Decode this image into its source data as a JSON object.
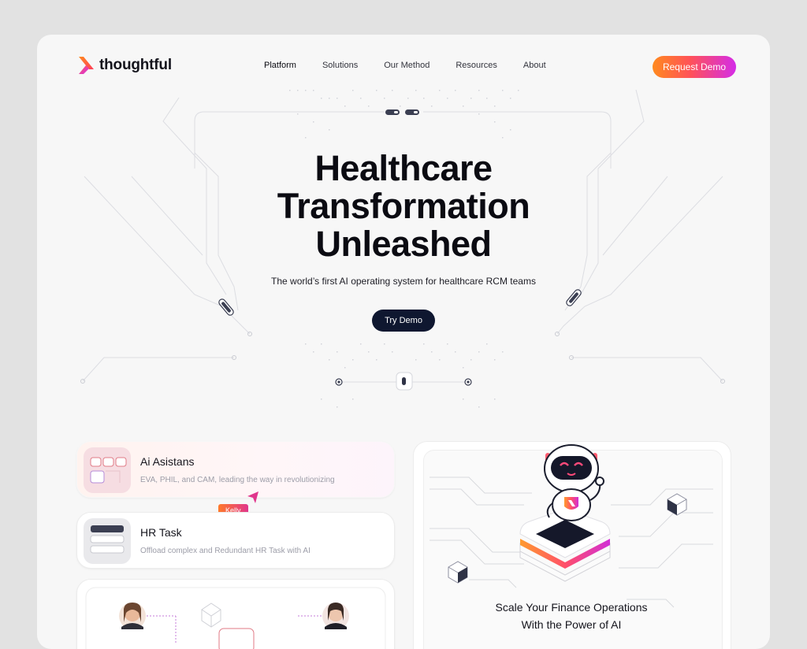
{
  "brand": {
    "name": "thoughtful"
  },
  "nav": {
    "items": [
      {
        "label": "Platform",
        "active": true
      },
      {
        "label": "Solutions",
        "active": false
      },
      {
        "label": "Our Method",
        "active": false
      },
      {
        "label": "Resources",
        "active": false
      },
      {
        "label": "About",
        "active": false
      }
    ],
    "cta": "Request Demo"
  },
  "hero": {
    "title_lines": [
      "Healthcare",
      "Transformation",
      "Unleashed"
    ],
    "subtitle": "The world’s first AI operating system for healthcare RCM teams",
    "cta": "Try Demo"
  },
  "features": [
    {
      "title": "Ai Asistans",
      "desc": "EVA, PHIL, and CAM, leading the way in revolutionizing"
    },
    {
      "title": "HR Task",
      "desc": "Offload complex and Redundant HR Task with AI"
    }
  ],
  "cursor_tag": "Kelly",
  "robot_card": {
    "line1": "Scale Your Finance Operations",
    "line2": "With the Power of AI"
  },
  "colors": {
    "accent_gradient": [
      "#ff8a1f",
      "#ff5258",
      "#d42ce8"
    ],
    "dark_button": "#0f1730",
    "background": "#f7f7f7"
  },
  "icons": [
    "logo-mark-icon",
    "robot-icon",
    "cube-icon",
    "cursor-icon",
    "toggle-icon",
    "avatar"
  ]
}
